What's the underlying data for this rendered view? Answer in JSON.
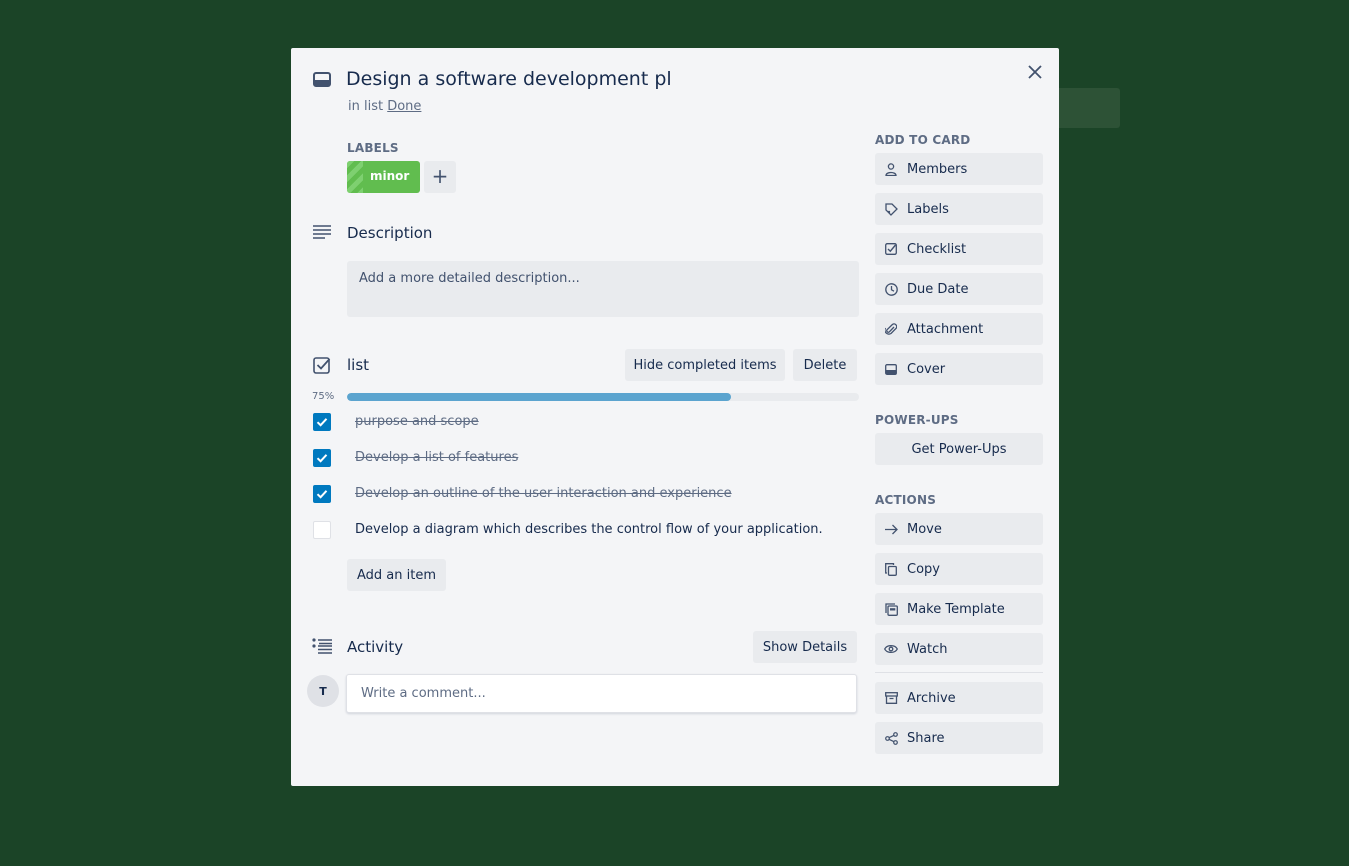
{
  "card": {
    "title": "Design a software development pl",
    "in_list_prefix": "in list",
    "list_name": "Done"
  },
  "labels": {
    "heading": "LABELS",
    "items": [
      {
        "text": "minor",
        "color": "#61bd4f"
      }
    ],
    "add_symbol": "+"
  },
  "description": {
    "heading": "Description",
    "placeholder": "Add a more detailed description..."
  },
  "checklist": {
    "title": "list",
    "hide_button": "Hide completed items",
    "delete_button": "Delete",
    "percent_label": "75%",
    "progress": 0.75,
    "items": [
      {
        "text": "purpose and scope",
        "checked": true
      },
      {
        "text": "Develop a list of features",
        "checked": true
      },
      {
        "text": "Develop an outline of the user interaction and experience",
        "checked": true
      },
      {
        "text": "Develop a diagram which describes the control flow of your application.",
        "checked": false
      }
    ],
    "add_item": "Add an item"
  },
  "activity": {
    "heading": "Activity",
    "show_details": "Show Details",
    "avatar_initial": "T",
    "comment_placeholder": "Write a comment..."
  },
  "sidebar": {
    "add_to_card": {
      "heading": "ADD TO CARD",
      "items": [
        {
          "label": "Members",
          "icon": "person-icon"
        },
        {
          "label": "Labels",
          "icon": "tag-icon"
        },
        {
          "label": "Checklist",
          "icon": "checkbox-icon"
        },
        {
          "label": "Due Date",
          "icon": "clock-icon"
        },
        {
          "label": "Attachment",
          "icon": "paperclip-icon"
        },
        {
          "label": "Cover",
          "icon": "card-icon"
        }
      ]
    },
    "power_ups": {
      "heading": "POWER-UPS",
      "button": "Get Power-Ups"
    },
    "actions": {
      "heading": "ACTIONS",
      "items": [
        {
          "label": "Move",
          "icon": "arrow-right-icon"
        },
        {
          "label": "Copy",
          "icon": "copy-icon"
        },
        {
          "label": "Make Template",
          "icon": "template-icon"
        },
        {
          "label": "Watch",
          "icon": "eye-icon"
        },
        {
          "label": "Archive",
          "icon": "archive-icon"
        },
        {
          "label": "Share",
          "icon": "share-icon"
        }
      ]
    }
  },
  "colors": {
    "background": "#1b4427",
    "modal": "#f4f5f7",
    "check_blue": "#0079bf",
    "progress": "#5ba4cf"
  }
}
